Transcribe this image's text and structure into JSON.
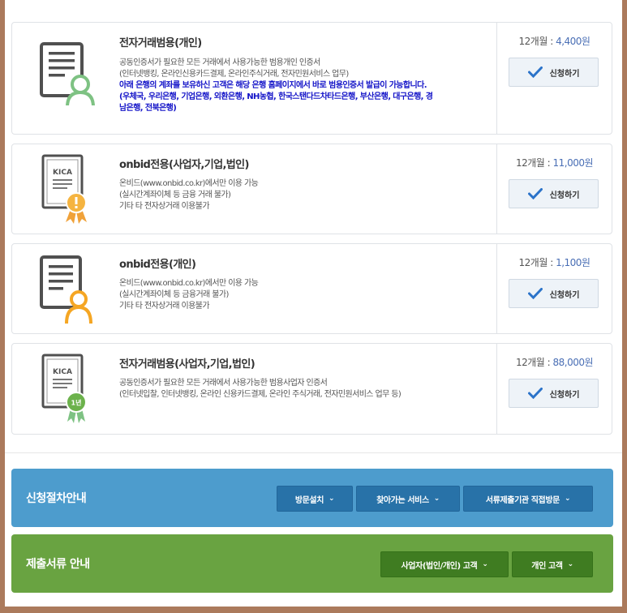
{
  "products": [
    {
      "title": "전자거래범용(개인)",
      "desc": [
        "공동인증서가 필요한 모든 거래에서 사용가능한 범용개인 인증서",
        "(인터넷뱅킹, 온라인신용카드결제, 온라인주식거래, 전자민원서비스 업무)"
      ],
      "notice": [
        "아래 은행의 계좌를 보유하신 고객은 해당 은행 홈페이지에서 바로 범용인증서 발급이 가능합니다.",
        "(우체국, 우리은행, 기업은행, 외환은행, NH농협, 한국스탠다드차타드은행, 부산은행, 대구은행, 경",
        "남은행, 전북은행)"
      ],
      "price_label": "12개월 : ",
      "price": "4,400원",
      "button": "신청하기"
    },
    {
      "title": "onbid전용(사업자,기업,법인)",
      "desc": [
        "온비드(www.onbid.co.kr)에서만 이용 가능",
        "(실시간계좌이체 등 금융 거래 불가)",
        "기타 타 전자상거래 이용불가"
      ],
      "price_label": "12개월 : ",
      "price": "11,000원",
      "button": "신청하기",
      "badge": "KICA"
    },
    {
      "title": "onbid전용(개인)",
      "desc": [
        "온비드(www.onbid.co.kr)에서만 이용 가능",
        "(실시간계좌이체 등 금융거래 불가)",
        "기타 타 전자상거래 이용불가"
      ],
      "price_label": "12개월 : ",
      "price": "1,100원",
      "button": "신청하기"
    },
    {
      "title": "전자거래범용(사업자,기업,법인)",
      "desc": [
        "공동인증서가 필요한 모든 거래에서 사용가능한 범용사업자 인증서",
        "(인터넷입찰, 인터넷뱅킹, 온라인 신용카드결제, 온라인 주식거래, 전자민원서비스 업무 등)"
      ],
      "price_label": "12개월 : ",
      "price": "88,000원",
      "button": "신청하기",
      "badge": "KICA",
      "seal": "1년"
    }
  ],
  "procedure": {
    "title": "신청절차안내",
    "buttons": [
      "방문설치",
      "찾아가는 서비스",
      "서류제출기관 직접방문"
    ]
  },
  "documents": {
    "title": "제출서류 안내",
    "buttons": [
      "사업자(법인/개인) 고객",
      "개인 고객"
    ]
  },
  "colors": {
    "procedure_bg": "#4d9ccd",
    "documents_bg": "#69a341",
    "price_accent": "#4a6fb5",
    "notice_text": "#1414c8",
    "frame_border": "#ab7a5c"
  }
}
